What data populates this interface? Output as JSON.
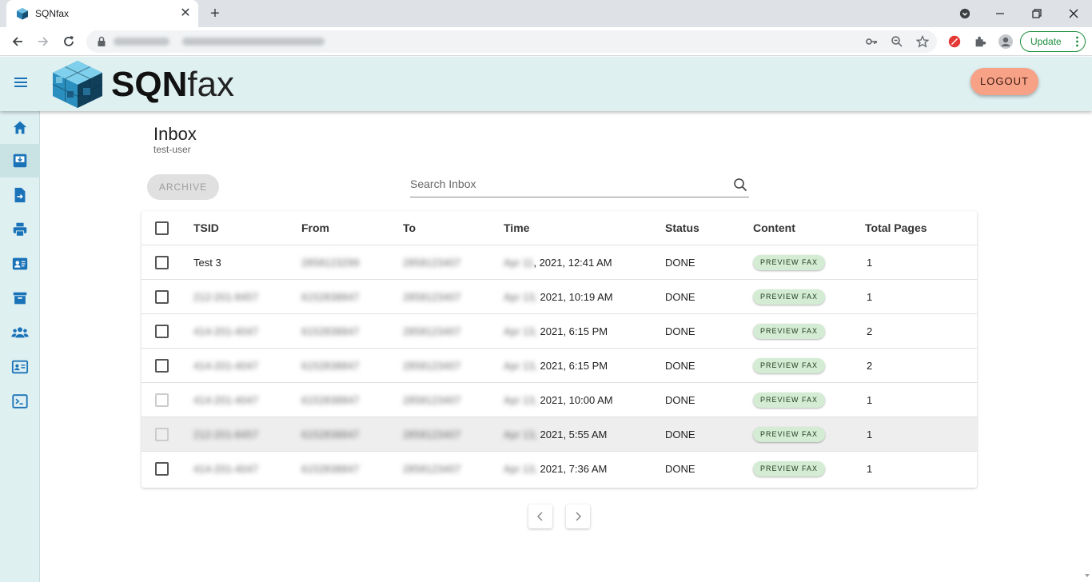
{
  "browser": {
    "tab_title": "SQNfax",
    "update_label": "Update"
  },
  "header": {
    "logo_bold": "SQN",
    "logo_light": "fax",
    "logout_label": "LOGOUT"
  },
  "sidebar": {
    "items": [
      {
        "icon": "home-icon"
      },
      {
        "icon": "inbox-icon",
        "active": true
      },
      {
        "icon": "send-fax-icon"
      },
      {
        "icon": "printer-icon"
      },
      {
        "icon": "contacts-icon"
      },
      {
        "icon": "archive-icon"
      },
      {
        "icon": "users-icon"
      },
      {
        "icon": "id-card-icon"
      },
      {
        "icon": "terminal-icon"
      }
    ]
  },
  "page": {
    "title": "Inbox",
    "subtitle": "test-user",
    "archive_label": "ARCHIVE",
    "search_placeholder": "Search Inbox"
  },
  "table": {
    "columns": [
      "TSID",
      "From",
      "To",
      "Time",
      "Status",
      "Content",
      "Total Pages"
    ],
    "rows": [
      {
        "tsid": "Test 3",
        "time": ", 2021, 12:41 AM",
        "status": "DONE",
        "content": "PREVIEW FAX",
        "pages": "1"
      },
      {
        "tsid": "",
        "time": "2021, 10:19 AM",
        "status": "DONE",
        "content": "PREVIEW FAX",
        "pages": "1"
      },
      {
        "tsid": "",
        "time": "2021, 6:15 PM",
        "status": "DONE",
        "content": "PREVIEW FAX",
        "pages": "2"
      },
      {
        "tsid": "",
        "time": "2021, 6:15 PM",
        "status": "DONE",
        "content": "PREVIEW FAX",
        "pages": "2"
      },
      {
        "tsid": "",
        "time": "2021, 10:00 AM",
        "status": "DONE",
        "content": "PREVIEW FAX",
        "pages": "1"
      },
      {
        "tsid": "",
        "time": "2021, 5:55 AM",
        "status": "DONE",
        "content": "PREVIEW FAX",
        "pages": "1"
      },
      {
        "tsid": "",
        "time": "2021, 7:36 AM",
        "status": "DONE",
        "content": "PREVIEW FAX",
        "pages": "1"
      }
    ]
  },
  "colors": {
    "header_bg": "#dff0f1",
    "accent_blue": "#1a73b8",
    "logout_bg": "#f7a187",
    "pill_bg": "#d4ecd4"
  }
}
